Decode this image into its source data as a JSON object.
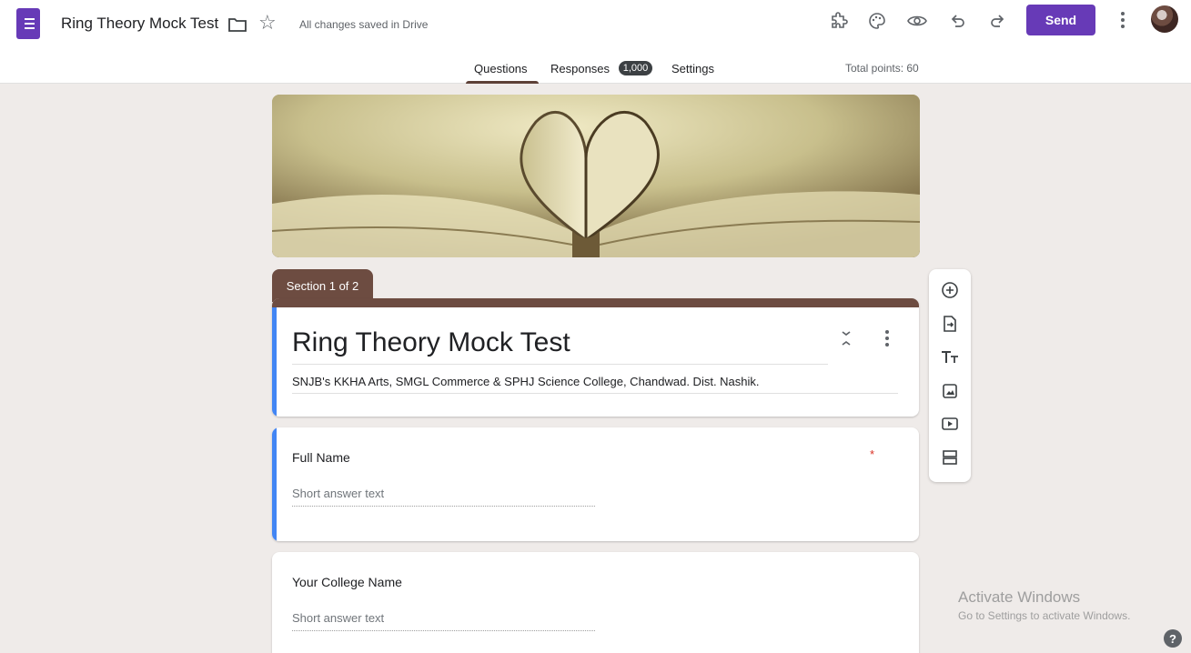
{
  "header": {
    "title": "Ring Theory Mock Test",
    "save_status": "All changes saved in Drive",
    "send_label": "Send",
    "icons": [
      "addon-puzzle-icon",
      "palette-icon",
      "preview-eye-icon",
      "undo-icon",
      "redo-icon",
      "more-vert-icon"
    ]
  },
  "tabs": {
    "questions": "Questions",
    "responses": "Responses",
    "responses_count": "1,000",
    "settings": "Settings"
  },
  "total_points": "Total points: 60",
  "section": {
    "label": "Section 1 of 2"
  },
  "form": {
    "title": "Ring Theory Mock Test",
    "description": "SNJB's KKHA Arts, SMGL Commerce & SPHJ Science College, Chandwad. Dist. Nashik."
  },
  "questions": [
    {
      "label": "Full Name",
      "placeholder": "Short answer text",
      "required_mark": "*"
    },
    {
      "label": "Your College Name",
      "placeholder": "Short answer text"
    }
  ],
  "toolbar": {
    "icons": [
      "add-question-icon",
      "import-questions-icon",
      "add-title-icon",
      "add-image-icon",
      "add-video-icon",
      "add-section-icon"
    ]
  },
  "watermark": {
    "line1": "Activate Windows",
    "line2": "Go to Settings to activate Windows."
  },
  "help": "?",
  "colors": {
    "accent": "#673ab7",
    "theme": "#6d4c41",
    "focus": "#4285f4",
    "background": "#efebe9"
  }
}
